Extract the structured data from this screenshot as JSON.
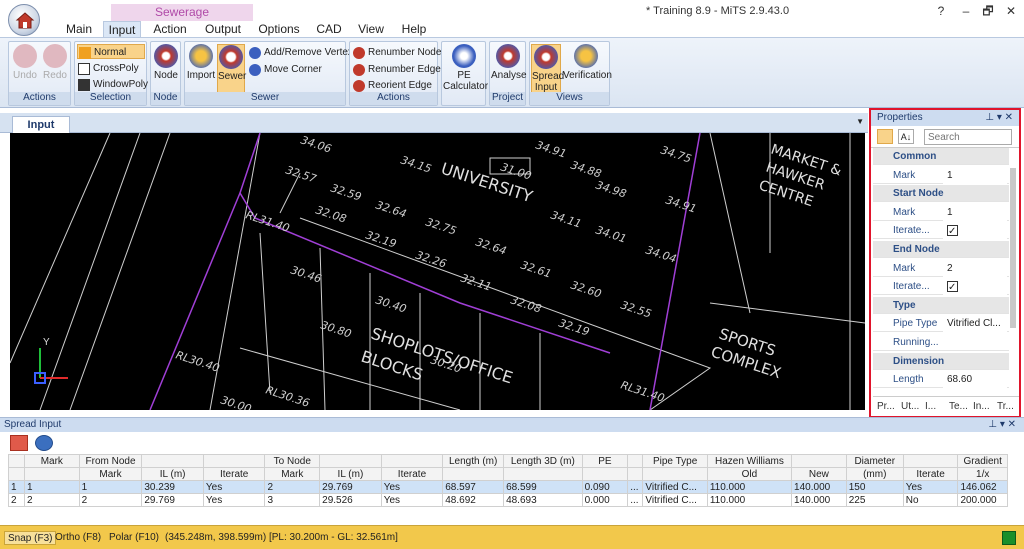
{
  "window": {
    "title": "* Training 8.9 - MiTS 2.9.43.0",
    "help": "?",
    "minimize": "–",
    "restore": "🗗",
    "close": "✕"
  },
  "context_tab": "Sewerage",
  "tabs": [
    "Main",
    "Input",
    "Action",
    "Output",
    "Options",
    "CAD",
    "View",
    "Help"
  ],
  "ribbon": {
    "actions": {
      "label": "Actions",
      "undo": "Undo",
      "redo": "Redo"
    },
    "selection": {
      "label": "Selection",
      "normal": "Normal",
      "crosspoly": "CrossPoly",
      "windowpoly": "WindowPoly"
    },
    "node": {
      "label": "Node",
      "node": "Node"
    },
    "sewer": {
      "label": "Sewer",
      "import": "Import",
      "sewer": "Sewer",
      "add_remove_vertex": "Add/Remove Vertex",
      "move_corner": "Move Corner"
    },
    "actions2": {
      "label": "Actions",
      "renumber_node": "Renumber Node",
      "renumber_edge": "Renumber Edge",
      "reorient_edge": "Reorient Edge"
    },
    "pe": {
      "label": "PE Calculator"
    },
    "project": {
      "label": "Project",
      "analyse": "Analyse"
    },
    "views": {
      "label": "Views",
      "spread_input": "Spread Input",
      "verification": "Verification"
    }
  },
  "doc_tab": "Input",
  "canvas": {
    "labels": [
      "34.06",
      "34.15",
      "34.91",
      "34.88",
      "34.98",
      "34.75",
      "31.00",
      "32.57",
      "32.59",
      "32.08",
      "32.64",
      "32.75",
      "32.19",
      "32.64",
      "32.26",
      "32.11",
      "32.61",
      "32.08",
      "32.60",
      "32.19",
      "32.55",
      "34.11",
      "34.01",
      "34.04",
      "34.91",
      "30.46",
      "30.40",
      "30.80",
      "30.20",
      "30.00",
      "RL30.40",
      "RL30.36",
      "RL31.40",
      "RL31.40"
    ],
    "text_university": "UNIVERSITY",
    "text_market": "MARKET &",
    "text_hawker": "HAWKER",
    "text_centre": "CENTRE",
    "text_shoplots": "SHOPLOTS/OFFICE",
    "text_blocks": "BLOCKS",
    "text_sports": "SPORTS",
    "text_complex": "COMPLEX",
    "axis_y": "Y"
  },
  "properties": {
    "title": "Properties",
    "search_placeholder": "Search",
    "rows": [
      {
        "type": "cat",
        "name": "Common"
      },
      {
        "type": "prop",
        "name": "Mark",
        "value": "1"
      },
      {
        "type": "cat",
        "name": "Start Node"
      },
      {
        "type": "prop",
        "name": "Mark",
        "value": "1"
      },
      {
        "type": "check",
        "name": "Iterate..."
      },
      {
        "type": "cat",
        "name": "End Node"
      },
      {
        "type": "prop",
        "name": "Mark",
        "value": "2"
      },
      {
        "type": "check",
        "name": "Iterate..."
      },
      {
        "type": "cat",
        "name": "Type"
      },
      {
        "type": "prop",
        "name": "Pipe Type",
        "value": "Vitrified Cl..."
      },
      {
        "type": "prop",
        "name": "Running...",
        "value": ""
      },
      {
        "type": "cat",
        "name": "Dimension"
      },
      {
        "type": "prop",
        "name": "Length",
        "value": "68.60"
      }
    ],
    "bottom_tabs": [
      "Pr...",
      "Ut...",
      "I...",
      "Te...",
      "In...",
      "Tr..."
    ]
  },
  "spread": {
    "title": "Spread Input",
    "headers1": [
      "",
      "Mark",
      "From Node",
      "",
      "",
      "To Node",
      "",
      "",
      "Length (m)",
      "Length 3D (m)",
      "PE",
      "",
      "Pipe Type",
      "Hazen Williams",
      "",
      "Diameter",
      "",
      "Gradient"
    ],
    "headers2": [
      "",
      "",
      "Mark",
      "IL (m)",
      "Iterate",
      "Mark",
      "IL (m)",
      "Iterate",
      "",
      "",
      "",
      "",
      "",
      "Old",
      "New",
      "(mm)",
      "Iterate",
      "1/x"
    ],
    "rows": [
      [
        "1",
        "1",
        "1",
        "30.239",
        "Yes",
        "2",
        "29.769",
        "Yes",
        "68.597",
        "68.599",
        "0.090",
        "...",
        "Vitrified C...",
        "110.000",
        "140.000",
        "150",
        "Yes",
        "146.062"
      ],
      [
        "2",
        "2",
        "2",
        "29.769",
        "Yes",
        "3",
        "29.526",
        "Yes",
        "48.692",
        "48.693",
        "0.000",
        "...",
        "Vitrified C...",
        "110.000",
        "140.000",
        "225",
        "No",
        "200.000"
      ]
    ]
  },
  "status": {
    "snap": "Snap (F3)",
    "ortho": "Ortho (F8)",
    "polar": "Polar (F10)",
    "coords": "(345.248m, 398.599m) [PL: 30.200m - GL: 32.561m]"
  }
}
